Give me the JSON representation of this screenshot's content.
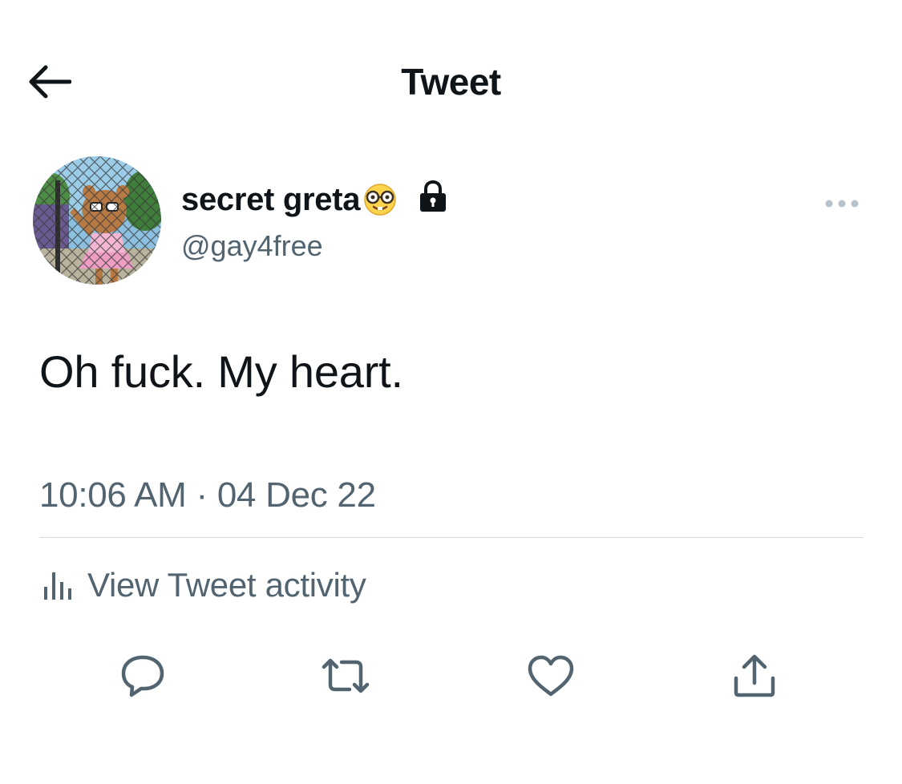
{
  "header": {
    "title": "Tweet",
    "back_icon": "arrow-left-icon"
  },
  "tweet": {
    "author": {
      "display_name": "secret greta",
      "handle": "@gay4free",
      "avatar": "avatar-image",
      "name_emoji": "nerd-face-emoji",
      "protected_icon": "lock-icon"
    },
    "more_icon": "more-horizontal-icon",
    "text": "Oh fuck. My heart.",
    "time": "10:06 AM",
    "separator": "·",
    "date": "04 Dec 22",
    "activity": {
      "icon": "bar-chart-icon",
      "label": "View Tweet activity"
    },
    "actions": [
      {
        "name": "reply",
        "icon": "reply-icon"
      },
      {
        "name": "retweet",
        "icon": "retweet-icon"
      },
      {
        "name": "like",
        "icon": "heart-icon"
      },
      {
        "name": "share",
        "icon": "share-icon"
      }
    ]
  },
  "colors": {
    "primary_text": "#0f1419",
    "secondary_text": "#536471",
    "divider": "#cfd9de",
    "background": "#ffffff"
  }
}
